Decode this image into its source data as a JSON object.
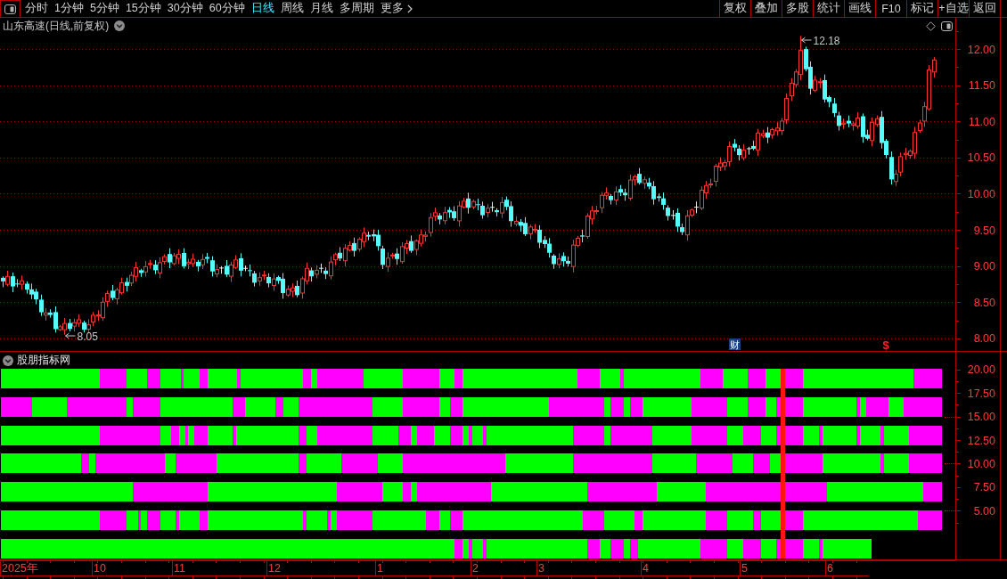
{
  "toolbar": {
    "periods": [
      {
        "label": "分时",
        "selected": false
      },
      {
        "label": "1分钟",
        "selected": false
      },
      {
        "label": "5分钟",
        "selected": false
      },
      {
        "label": "15分钟",
        "selected": false
      },
      {
        "label": "30分钟",
        "selected": false
      },
      {
        "label": "60分钟",
        "selected": false
      },
      {
        "label": "日线",
        "selected": true
      },
      {
        "label": "周线",
        "selected": false
      },
      {
        "label": "月线",
        "selected": false
      },
      {
        "label": "多周期",
        "selected": false
      }
    ],
    "more": "更多",
    "actions": [
      "复权",
      "叠加",
      "多股",
      "统计",
      "画线",
      "F10",
      "标记",
      "+自选",
      "返回"
    ]
  },
  "price_panel": {
    "title": "山东高速(日线,前复权)",
    "y_axis_labels": [
      "12.00",
      "11.50",
      "11.00",
      "10.50",
      "10.00",
      "9.50",
      "9.00",
      "8.50",
      "8.00"
    ],
    "high_label": "12.18",
    "low_label": "8.05",
    "event_markers": [
      {
        "kind": "finance",
        "text": "财"
      },
      {
        "kind": "dividend",
        "text": "$"
      }
    ]
  },
  "indicator_panel": {
    "title": "股朋指标网",
    "y_axis_labels": [
      "20.00",
      "17.50",
      "15.00",
      "12.50",
      "10.00",
      "7.50",
      "5.00"
    ],
    "strips": [
      {
        "segments": [
          {
            "color": "#00ff00"
          },
          {
            "color": "#ff00ff"
          },
          {
            "color": "#00ff00"
          },
          {
            "color": "#ff00ff"
          },
          {
            "color": "#00ff00"
          },
          {
            "color": "#ff00ff"
          },
          {
            "color": "#00ff00"
          },
          {
            "color": "#ff00ff"
          },
          {
            "color": "#00ff00"
          },
          {
            "color": "#ff00ff"
          },
          {
            "color": "#00ff00"
          },
          {
            "color": "#ff00ff"
          },
          {
            "color": "#00ff00"
          },
          {
            "color": "#ff00ff"
          },
          {
            "color": "#00ff00"
          },
          {
            "color": "#ff00ff"
          },
          {
            "color": "#00ff00"
          },
          {
            "color": "#ff00ff"
          },
          {
            "color": "#00ff00"
          },
          {
            "color": "#ff00ff"
          },
          {
            "color": "#00ff00"
          },
          {
            "color": "#ff00ff"
          },
          {
            "color": "#00ff00"
          },
          {
            "color": "#ff00ff"
          },
          {
            "color": "#00ff00"
          },
          {
            "color": "#ff00ff"
          },
          {
            "color": "#00ff00"
          },
          {
            "color": "#ff00ff"
          },
          {
            "color": "#00ff00"
          },
          {
            "color": "#ff00ff"
          }
        ]
      },
      {
        "segments": [
          {
            "color": "#ff00ff"
          },
          {
            "color": "#00ff00"
          },
          {
            "color": "#ff00ff"
          },
          {
            "color": "#00ff00"
          },
          {
            "color": "#ff00ff"
          },
          {
            "color": "#00ff00"
          },
          {
            "color": "#ff00ff"
          },
          {
            "color": "#00ff00"
          },
          {
            "color": "#ff00ff"
          },
          {
            "color": "#00ff00"
          },
          {
            "color": "#ff00ff"
          },
          {
            "color": "#00ff00"
          },
          {
            "color": "#ff00ff"
          },
          {
            "color": "#00ff00"
          },
          {
            "color": "#ff00ff"
          },
          {
            "color": "#00ff00"
          },
          {
            "color": "#ff00ff"
          },
          {
            "color": "#00ff00"
          },
          {
            "color": "#ff00ff"
          },
          {
            "color": "#00ff00"
          },
          {
            "color": "#ff00ff"
          },
          {
            "color": "#00ff00"
          },
          {
            "color": "#ff00ff"
          },
          {
            "color": "#00ff00"
          },
          {
            "color": "#ff00ff"
          },
          {
            "color": "#00ff00"
          },
          {
            "color": "#ff00ff"
          },
          {
            "color": "#00ff00"
          },
          {
            "color": "#ff00ff"
          },
          {
            "color": "#00ff00"
          },
          {
            "color": "#ff00ff"
          },
          {
            "color": "#00ff00"
          },
          {
            "color": "#ff00ff"
          }
        ]
      },
      {
        "segments": [
          {
            "color": "#00ff00"
          },
          {
            "color": "#ff00ff"
          },
          {
            "color": "#00ff00"
          },
          {
            "color": "#ff00ff"
          },
          {
            "color": "#00ff00"
          },
          {
            "color": "#ff00ff"
          },
          {
            "color": "#00ff00"
          },
          {
            "color": "#ff00ff"
          },
          {
            "color": "#00ff00"
          },
          {
            "color": "#ff00ff"
          },
          {
            "color": "#00ff00"
          },
          {
            "color": "#ff00ff"
          },
          {
            "color": "#00ff00"
          },
          {
            "color": "#ff00ff"
          },
          {
            "color": "#00ff00"
          },
          {
            "color": "#ff00ff"
          },
          {
            "color": "#00ff00"
          },
          {
            "color": "#ff00ff"
          },
          {
            "color": "#00ff00"
          },
          {
            "color": "#ff00ff"
          },
          {
            "color": "#00ff00"
          },
          {
            "color": "#ff00ff"
          },
          {
            "color": "#00ff00"
          },
          {
            "color": "#ff00ff"
          },
          {
            "color": "#00ff00"
          },
          {
            "color": "#ff00ff"
          },
          {
            "color": "#00ff00"
          },
          {
            "color": "#ff00ff"
          },
          {
            "color": "#00ff00"
          },
          {
            "color": "#ff00ff"
          },
          {
            "color": "#00ff00"
          },
          {
            "color": "#ff00ff"
          },
          {
            "color": "#00ff00"
          },
          {
            "color": "#ff00ff"
          },
          {
            "color": "#00ff00"
          },
          {
            "color": "#ff00ff"
          },
          {
            "color": "#00ff00"
          },
          {
            "color": "#ff00ff"
          },
          {
            "color": "#00ff00"
          },
          {
            "color": "#ff00ff"
          },
          {
            "color": "#00ff00"
          },
          {
            "color": "#ff00ff"
          }
        ]
      },
      {
        "segments": [
          {
            "color": "#00ff00"
          },
          {
            "color": "#ff00ff"
          },
          {
            "color": "#00ff00"
          },
          {
            "color": "#ff00ff"
          },
          {
            "color": "#00ff00"
          },
          {
            "color": "#ff00ff"
          },
          {
            "color": "#00ff00"
          },
          {
            "color": "#ff00ff"
          },
          {
            "color": "#00ff00"
          },
          {
            "color": "#ff00ff"
          },
          {
            "color": "#00ff00"
          },
          {
            "color": "#ff00ff"
          },
          {
            "color": "#00ff00"
          },
          {
            "color": "#ff00ff"
          },
          {
            "color": "#00ff00"
          },
          {
            "color": "#ff00ff"
          },
          {
            "color": "#00ff00"
          },
          {
            "color": "#ff00ff"
          },
          {
            "color": "#00ff00"
          },
          {
            "color": "#ff00ff"
          },
          {
            "color": "#00ff00"
          },
          {
            "color": "#ff00ff"
          },
          {
            "color": "#00ff00"
          },
          {
            "color": "#ff00ff"
          }
        ]
      },
      {
        "segments": [
          {
            "color": "#00ff00"
          },
          {
            "color": "#ff00ff"
          },
          {
            "color": "#00ff00"
          },
          {
            "color": "#ff00ff"
          },
          {
            "color": "#00ff00"
          },
          {
            "color": "#ff00ff"
          },
          {
            "color": "#00ff00"
          },
          {
            "color": "#ff00ff"
          },
          {
            "color": "#00ff00"
          },
          {
            "color": "#ff00ff"
          },
          {
            "color": "#00ff00"
          },
          {
            "color": "#ff00ff"
          },
          {
            "color": "#00ff00"
          },
          {
            "color": "#ff00ff"
          }
        ]
      },
      {
        "segments": [
          {
            "color": "#00ff00"
          },
          {
            "color": "#ff00ff"
          },
          {
            "color": "#00ff00"
          },
          {
            "color": "#ff00ff"
          },
          {
            "color": "#00ff00"
          },
          {
            "color": "#ff00ff"
          },
          {
            "color": "#00ff00"
          },
          {
            "color": "#ff00ff"
          },
          {
            "color": "#00ff00"
          },
          {
            "color": "#ff00ff"
          },
          {
            "color": "#00ff00"
          },
          {
            "color": "#ff00ff"
          },
          {
            "color": "#00ff00"
          },
          {
            "color": "#ff00ff"
          },
          {
            "color": "#00ff00"
          },
          {
            "color": "#ff00ff"
          },
          {
            "color": "#00ff00"
          },
          {
            "color": "#ff00ff"
          },
          {
            "color": "#00ff00"
          },
          {
            "color": "#ff00ff"
          },
          {
            "color": "#00ff00"
          },
          {
            "color": "#ff00ff"
          },
          {
            "color": "#00ff00"
          },
          {
            "color": "#ff00ff"
          },
          {
            "color": "#00ff00"
          },
          {
            "color": "#ff00ff"
          },
          {
            "color": "#00ff00"
          },
          {
            "color": "#ff00ff"
          },
          {
            "color": "#00ff00"
          },
          {
            "color": "#ff00ff"
          },
          {
            "color": "#00ff00"
          },
          {
            "color": "#ff00ff"
          }
        ]
      },
      {
        "segments": [
          {
            "color": "#00ff00"
          },
          {
            "color": "#ff00ff"
          },
          {
            "color": "#00ff00"
          },
          {
            "color": "#ff00ff"
          },
          {
            "color": "#00ff00"
          },
          {
            "color": "#ff00ff"
          },
          {
            "color": "#00ff00"
          },
          {
            "color": "#ff00ff"
          },
          {
            "color": "#00ff00"
          },
          {
            "color": "#ff00ff"
          },
          {
            "color": "#00ff00"
          },
          {
            "color": "#ff00ff"
          },
          {
            "color": "#00ff00"
          },
          {
            "color": "#ff00ff"
          },
          {
            "color": "#00ff00"
          },
          {
            "color": "#ff00ff"
          },
          {
            "color": "#00ff00"
          },
          {
            "color": "#ff00ff"
          },
          {
            "color": "#00ff00"
          },
          {
            "color": "#ff00ff"
          },
          {
            "color": "#00ff00"
          }
        ]
      }
    ]
  },
  "time_axis": {
    "labels": [
      "2025年",
      "10",
      "11",
      "12",
      "1",
      "2",
      "3",
      "4",
      "5",
      "6"
    ]
  }
}
